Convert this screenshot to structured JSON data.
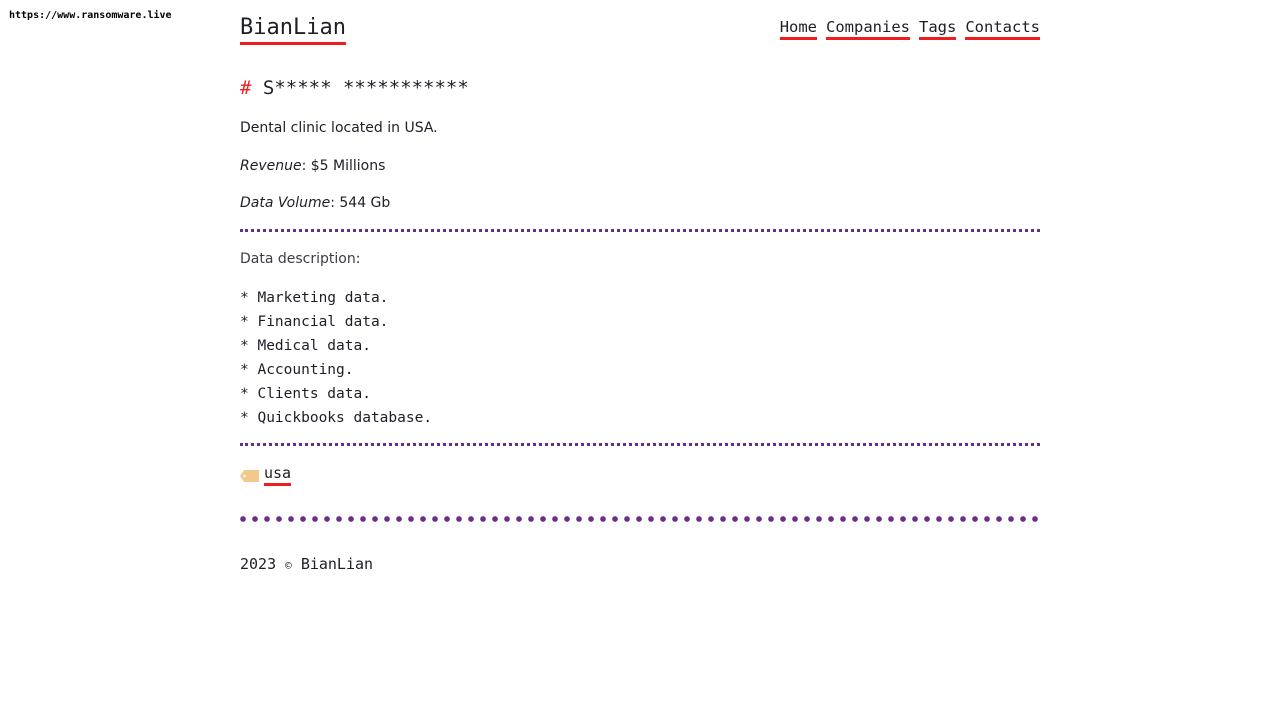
{
  "watermark": "https://www.ransomware.live",
  "header": {
    "logo": "BianLian",
    "nav": [
      "Home",
      "Companies",
      "Tags",
      "Contacts"
    ]
  },
  "post": {
    "hash": "#",
    "title": "S***** ***********",
    "description": "Dental clinic located in USA.",
    "revenue_label": "Revenue",
    "revenue_value": ": $5 Millions",
    "volume_label": "Data Volume",
    "volume_value": ": 544 Gb",
    "data_description_label": "Data description",
    "data_description_colon": ":",
    "data_items": [
      "* Marketing data.",
      "* Financial data.",
      "* Medical data.",
      "* Accounting.",
      "* Clients data.",
      "* Quickbooks database."
    ],
    "tag_icon": "tag-icon",
    "tag": "usa"
  },
  "footer": {
    "year": "2023",
    "copyright": "©",
    "name": "BianLian"
  },
  "colors": {
    "accent_red": "#ef1d1d",
    "rule_purple": "#6b2d8c",
    "text": "#1d1f27",
    "tag_icon": "#f3c98b"
  }
}
